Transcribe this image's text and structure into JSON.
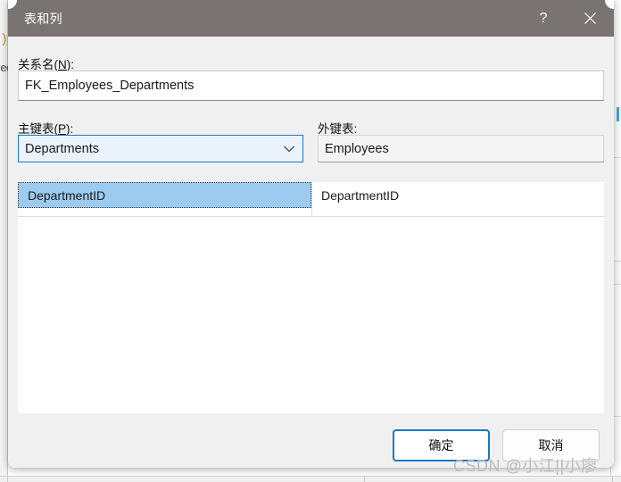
{
  "window": {
    "title": "表和列",
    "help_glyph": "?",
    "close_glyph": "×"
  },
  "form": {
    "relation_name": {
      "label_prefix": "关系名(",
      "label_accel": "N",
      "label_suffix": "):",
      "value": "FK_Employees_Departments"
    },
    "primary_key_table": {
      "label_prefix": "主键表(",
      "label_accel": "P",
      "label_suffix": "):",
      "value": "Departments"
    },
    "foreign_key_table": {
      "label": "外键表:",
      "value": "Employees"
    }
  },
  "grid": {
    "rows": [
      {
        "primary_column": "DepartmentID",
        "foreign_column": "DepartmentID",
        "selected": true
      },
      {
        "primary_column": "",
        "foreign_column": "",
        "selected": false
      }
    ]
  },
  "footer": {
    "ok_label": "确定",
    "cancel_label": "取消"
  },
  "watermark": {
    "text": "CSDN @小江||小廖"
  },
  "background": {
    "code_fragment_1": ")",
    "code_fragment_2": "ee"
  },
  "colors": {
    "titlebar": "#7a7373",
    "dialog_face": "#f0f0f0",
    "accent_blue": "#1878c8",
    "selection_blue": "#9ccbef"
  }
}
